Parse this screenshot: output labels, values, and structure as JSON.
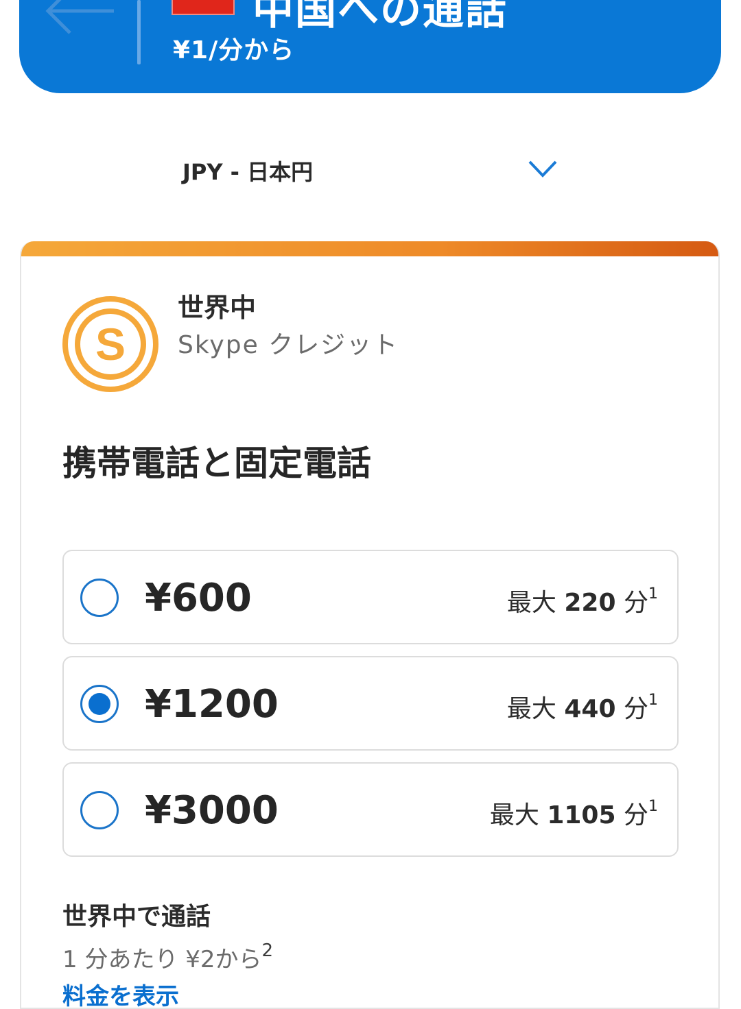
{
  "header": {
    "title": "中国への通話",
    "subtitle": "¥1/分から",
    "back_icon": "back-arrow-icon",
    "flag_icon": "china-flag-icon",
    "color": "#0a78d6"
  },
  "currency": {
    "selected": "JPY - 日本円",
    "icon": "chevron-down-icon"
  },
  "plan": {
    "title": "世界中",
    "subtitle": "Skype クレジット",
    "icon": "skype-credit-icon",
    "accent_color": "#f5a83a",
    "section_title": "携帯電話と固定電話",
    "options": [
      {
        "price": "¥600",
        "minutes_prefix": "最大",
        "minutes_value": "220",
        "minutes_unit": "分",
        "footnote": "1",
        "selected": false
      },
      {
        "price": "¥1200",
        "minutes_prefix": "最大",
        "minutes_value": "440",
        "minutes_unit": "分",
        "footnote": "1",
        "selected": true
      },
      {
        "price": "¥3000",
        "minutes_prefix": "最大",
        "minutes_value": "1105",
        "minutes_unit": "分",
        "footnote": "1",
        "selected": false
      }
    ],
    "world_title": "世界中で通話",
    "world_rate": "1 分あたり ¥2から",
    "world_rate_footnote": "2",
    "rates_link": "料金を表示"
  }
}
